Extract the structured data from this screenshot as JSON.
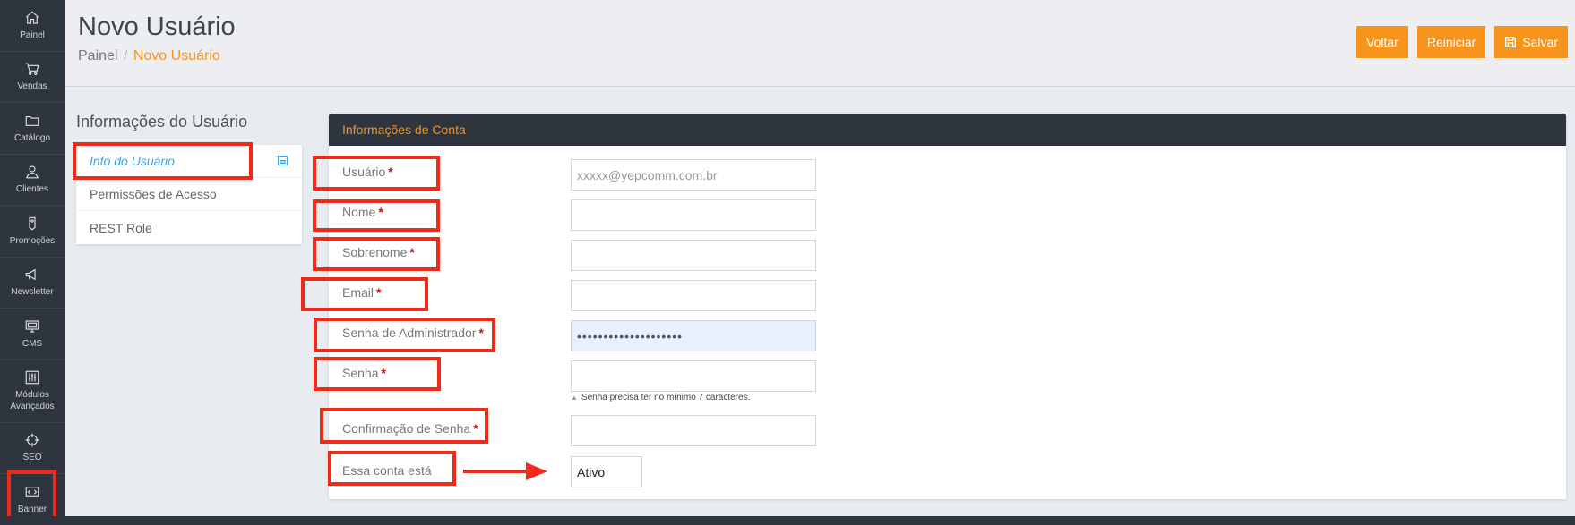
{
  "sidebar": {
    "items": [
      {
        "label": "Painel",
        "icon": "home-icon"
      },
      {
        "label": "Vendas",
        "icon": "cart-icon"
      },
      {
        "label": "Catálogo",
        "icon": "folder-icon"
      },
      {
        "label": "Clientes",
        "icon": "user-icon"
      },
      {
        "label": "Promoções",
        "icon": "tag-icon"
      },
      {
        "label": "Newsletter",
        "icon": "megaphone-icon"
      },
      {
        "label": "CMS",
        "icon": "monitor-icon"
      },
      {
        "label": "Módulos Avançados",
        "icon": "sliders-icon"
      },
      {
        "label": "SEO",
        "icon": "crosshair-icon"
      },
      {
        "label": "Banner",
        "icon": "code-icon"
      }
    ]
  },
  "header": {
    "title": "Novo Usuário",
    "breadcrumb_root": "Painel",
    "breadcrumb_sep": "/",
    "breadcrumb_current": "Novo Usuário",
    "buttons": {
      "back": "Voltar",
      "reset": "Reiniciar",
      "save": "Salvar"
    }
  },
  "tabs": {
    "title": "Informações do Usuário",
    "items": [
      "Info do Usuário",
      "Permissões de Acesso",
      "REST Role"
    ]
  },
  "form": {
    "section_title": "Informações de Conta",
    "required_mark": "*",
    "fields": {
      "user": {
        "label": "Usuário",
        "placeholder": "xxxxx@yepcomm.com.br"
      },
      "first_name": {
        "label": "Nome"
      },
      "last_name": {
        "label": "Sobrenome"
      },
      "email": {
        "label": "Email"
      },
      "admin_password": {
        "label": "Senha de Administrador",
        "value": "••••••••••••••••••••"
      },
      "password": {
        "label": "Senha",
        "hint": "Senha precisa ter no mínimo 7 caracteres."
      },
      "password_confirm": {
        "label": "Confirmação de Senha"
      },
      "status": {
        "label": "Essa conta está",
        "value": "Ativo"
      }
    }
  },
  "colors": {
    "accent": "#f7941d",
    "sidebar": "#2f353e",
    "annotation": "#ee2a1b",
    "link": "#3fa7e0"
  }
}
